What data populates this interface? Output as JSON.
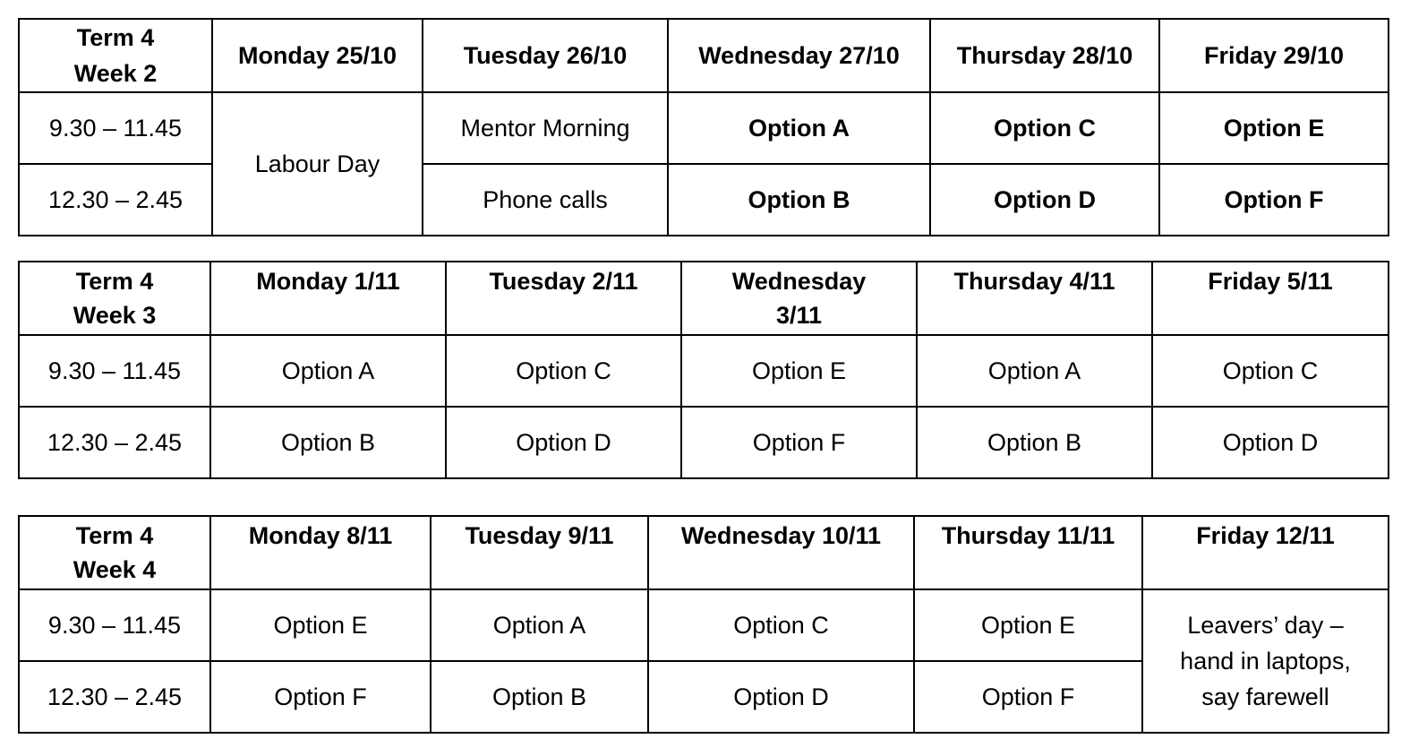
{
  "weeks": [
    {
      "term_line": "Term 4",
      "week_line": "Week 2",
      "days": [
        "Monday 25/10",
        "Tuesday 26/10",
        "Wednesday 27/10",
        "Thursday 28/10",
        "Friday 29/10"
      ],
      "slots": [
        "9.30 – 11.45",
        "12.30 – 2.45"
      ],
      "monday_merged": "Labour Day",
      "tuesday": [
        "Mentor Morning",
        "Phone calls"
      ],
      "wednesday": [
        "Option A",
        "Option B"
      ],
      "thursday": [
        "Option C",
        "Option D"
      ],
      "friday": [
        "Option E",
        "Option F"
      ]
    },
    {
      "term_line": "Term 4",
      "week_line": "Week 3",
      "days": [
        "Monday 1/11",
        "Tuesday 2/11",
        "Wednesday 3/11",
        "Thursday 4/11",
        "Friday 5/11"
      ],
      "slots": [
        "9.30 – 11.45",
        "12.30 – 2.45"
      ],
      "rows": [
        [
          "Option A",
          "Option C",
          "Option E",
          "Option A",
          "Option C"
        ],
        [
          "Option B",
          "Option D",
          "Option F",
          "Option B",
          "Option D"
        ]
      ]
    },
    {
      "term_line": "Term 4",
      "week_line": "Week 4",
      "days": [
        "Monday 8/11",
        "Tuesday 9/11",
        "Wednesday 10/11",
        "Thursday 11/11",
        "Friday 12/11"
      ],
      "slots": [
        "9.30 – 11.45",
        "12.30 – 2.45"
      ],
      "rows": [
        [
          "Option E",
          "Option A",
          "Option C",
          "Option E"
        ],
        [
          "Option F",
          "Option B",
          "Option D",
          "Option F"
        ]
      ],
      "friday_merged": "Leavers’ day – hand in laptops, say farewell"
    }
  ]
}
